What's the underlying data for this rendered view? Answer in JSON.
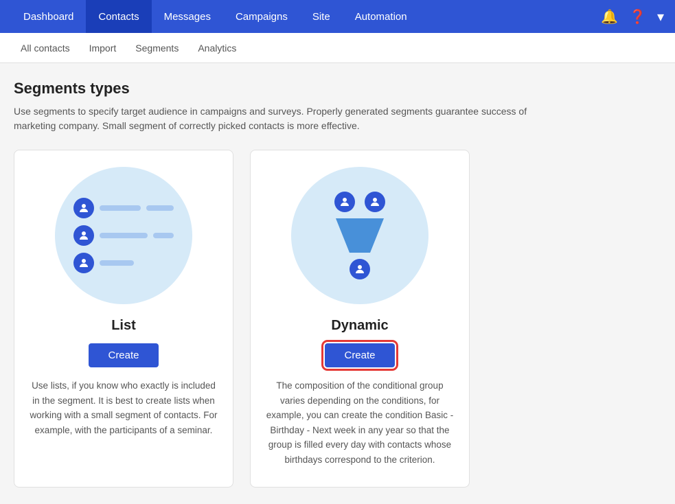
{
  "nav": {
    "items": [
      {
        "label": "Dashboard",
        "active": false
      },
      {
        "label": "Contacts",
        "active": true
      },
      {
        "label": "Messages",
        "active": false
      },
      {
        "label": "Campaigns",
        "active": false
      },
      {
        "label": "Site",
        "active": false
      },
      {
        "label": "Automation",
        "active": false
      }
    ],
    "icons": {
      "bell": "🔔",
      "help": "❓",
      "dropdown": "▾"
    }
  },
  "subnav": {
    "items": [
      {
        "label": "All contacts"
      },
      {
        "label": "Import"
      },
      {
        "label": "Segments"
      },
      {
        "label": "Analytics"
      }
    ]
  },
  "page": {
    "title": "Segments types",
    "description": "Use segments to specify target audience in campaigns and surveys. Properly generated segments guarantee success of marketing company. Small segment of correctly picked contacts is more effective."
  },
  "cards": [
    {
      "type": "list",
      "label": "List",
      "button": "Create",
      "description": "Use lists, if you know who exactly is included in the segment. It is best to create lists when working with a small segment of contacts. For example, with the participants of a seminar.",
      "highlighted": false
    },
    {
      "type": "dynamic",
      "label": "Dynamic",
      "button": "Create",
      "description": "The composition of the conditional group varies depending on the conditions, for example, you can create the condition Basic - Birthday - Next week in any year so that the group is filled every day with contacts whose birthdays correspond to the criterion.",
      "highlighted": true
    }
  ]
}
